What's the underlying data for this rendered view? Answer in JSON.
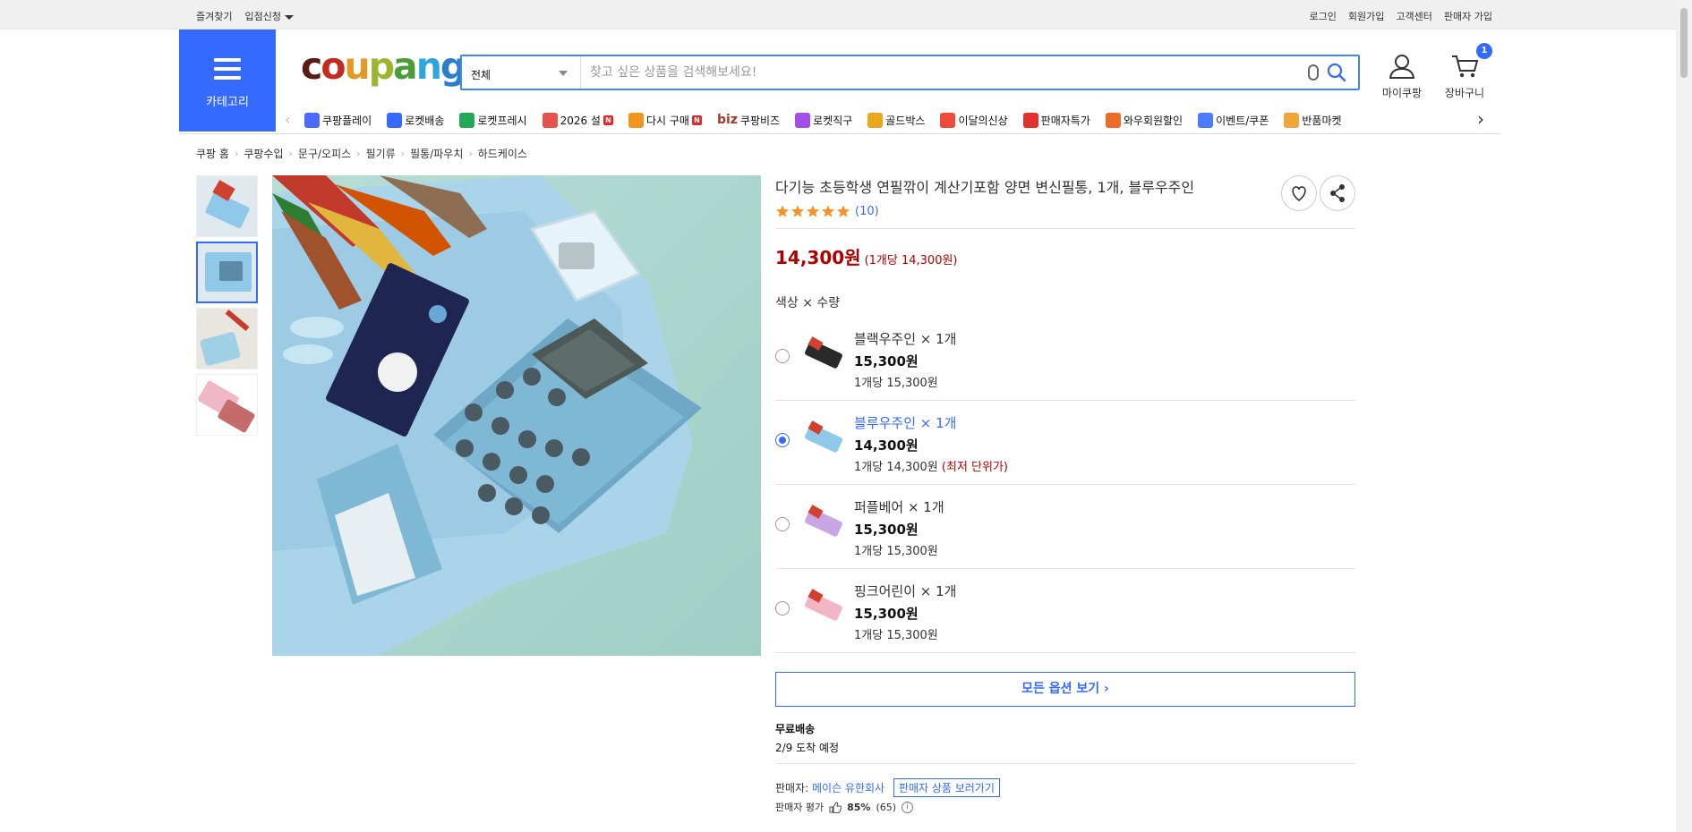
{
  "topbar": {
    "left": [
      "즐겨찾기",
      "입점신청"
    ],
    "right": [
      "로그인",
      "회원가입",
      "고객센터",
      "판매자 가입"
    ]
  },
  "category_button": "카테고리",
  "logo": {
    "text": "coupang"
  },
  "search": {
    "scope": "전체",
    "placeholder": "찾고 싶은 상품을 검색해보세요!"
  },
  "header_icons": {
    "mypage": "마이쿠팡",
    "cart": "장바구니",
    "cart_count": "1"
  },
  "nav": [
    {
      "label": "쿠팡플레이",
      "icon": "play-icon",
      "color": "#4b6bff"
    },
    {
      "label": "로켓배송",
      "icon": "rocket-icon",
      "color": "#346aff"
    },
    {
      "label": "로켓프레시",
      "icon": "rocket-fresh-icon",
      "color": "#21a957"
    },
    {
      "label": "2026 설",
      "icon": "gift-icon",
      "color": "#e5534b",
      "badge": "N"
    },
    {
      "label": "다시 구매",
      "icon": "home-icon",
      "color": "#f0961e",
      "badge": "N"
    },
    {
      "label": "쿠팡비즈",
      "prefix": "biz",
      "icon": "biz-icon",
      "color": "#9b3b2a"
    },
    {
      "label": "로켓직구",
      "icon": "rocket-global-icon",
      "color": "#a44ee8"
    },
    {
      "label": "골드박스",
      "icon": "goldbox-icon",
      "color": "#e8a71c"
    },
    {
      "label": "이달의신상",
      "icon": "new-icon",
      "color": "#ef4b3a"
    },
    {
      "label": "판매자특가",
      "icon": "percent-icon",
      "color": "#e0312a"
    },
    {
      "label": "와우회원할인",
      "icon": "wow-icon",
      "color": "#ef6b2a"
    },
    {
      "label": "이벤트/쿠폰",
      "icon": "coupon-icon",
      "color": "#4b7cff"
    },
    {
      "label": "반품마켓",
      "icon": "market-icon",
      "color": "#f0a63a"
    }
  ],
  "breadcrumb": [
    "쿠팡 홈",
    "쿠팡수입",
    "문구/오피스",
    "필기류",
    "필통/파우치",
    "하드케이스"
  ],
  "product": {
    "title": "다기능 초등학생 연필깎이 계산기포함 양면 변신필통, 1개, 블루우주인",
    "rating": 5,
    "review_count": "(10)",
    "price": "14,300원",
    "unit_price": "(1개당 14,300원)",
    "option_label": "색상 × 수량",
    "options": [
      {
        "name": "블랙우주인 × 1개",
        "price": "15,300원",
        "unit": "1개당 15,300원",
        "note": "",
        "selected": false,
        "color": "#2a2a2a"
      },
      {
        "name": "블루우주인 × 1개",
        "price": "14,300원",
        "unit": "1개당 14,300원",
        "note": "(최저 단위가)",
        "selected": true,
        "color": "#8fc8e8"
      },
      {
        "name": "퍼플베어 × 1개",
        "price": "15,300원",
        "unit": "1개당 15,300원",
        "note": "",
        "selected": false,
        "color": "#c7a6e6"
      },
      {
        "name": "핑크어린이 × 1개",
        "price": "15,300원",
        "unit": "1개당 15,300원",
        "note": "",
        "selected": false,
        "color": "#f2b5c6"
      }
    ],
    "all_options_button": "모든 옵션 보기 ›",
    "shipping": {
      "title": "무료배송",
      "arrival": "2/9 도착 예정"
    },
    "seller": {
      "label": "판매자:",
      "name": "메이슨 유한회사",
      "link": "판매자 상품 보러가기",
      "rating_label": "판매자 평가",
      "rating_percent": "85%",
      "rating_count": "(65)"
    }
  },
  "colors": {
    "accent": "#346aff",
    "price": "#ae0000",
    "star": "#f5922a"
  }
}
